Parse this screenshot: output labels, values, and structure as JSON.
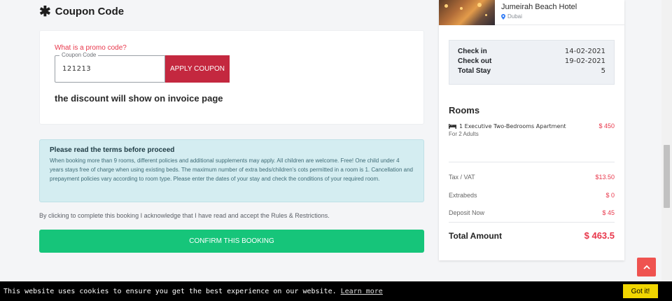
{
  "coupon": {
    "heading": "Coupon Code",
    "promo_link": "What is a promo code?",
    "field_legend": "Coupon Code",
    "field_value": "121213",
    "apply_label": "APPLY COUPON",
    "discount_note": "the discount will show on invoice page"
  },
  "terms": {
    "title": "Please read the terms before proceed",
    "text": "When booking more than 9 rooms, different policies and additional supplements may apply. All children are welcome. Free! One child under 4 years stays free of charge when using existing beds. The maximum number of extra beds/children's cots permitted in a room is 1. Cancellation and prepayment policies vary according to room type. Please enter the dates of your stay and check the conditions of your required room."
  },
  "acknowledgement": "By clicking to complete this booking I acknowledge that I have read and accept the Rules & Restrictions.",
  "confirm_label": "CONFIRM THIS BOOKING",
  "summary": {
    "hotel_name": "Jumeirah Beach Hotel",
    "hotel_location": "Dubai",
    "check_in_label": "Check in",
    "check_in_value": "14-02-2021",
    "check_out_label": "Check out",
    "check_out_value": "19-02-2021",
    "total_stay_label": "Total Stay",
    "total_stay_value": "5",
    "rooms_title": "Rooms",
    "room_name": "1 Executive Two-Bedrooms Apartment",
    "room_price": "$ 450",
    "room_guests": "For 2 Adults",
    "tax_label": "Tax / VAT",
    "tax_value": "$13.50",
    "extrabeds_label": "Extrabeds",
    "extrabeds_value": "$ 0",
    "deposit_label": "Deposit Now",
    "deposit_value": "$ 45",
    "total_label": "Total Amount",
    "total_value": "$ 463.5"
  },
  "cookie": {
    "text": "This website uses cookies to ensure you get the best experience on our website.",
    "link_label": "Learn more",
    "button_label": "Got it!"
  },
  "colors": {
    "accent_red": "#c4283f",
    "confirm_green": "#16c57a",
    "price_red": "#e8374b",
    "cookie_button": "#f1d600"
  },
  "icons": [
    "asterisk-icon",
    "location-pin-icon",
    "bed-icon",
    "chevron-up-icon"
  ]
}
